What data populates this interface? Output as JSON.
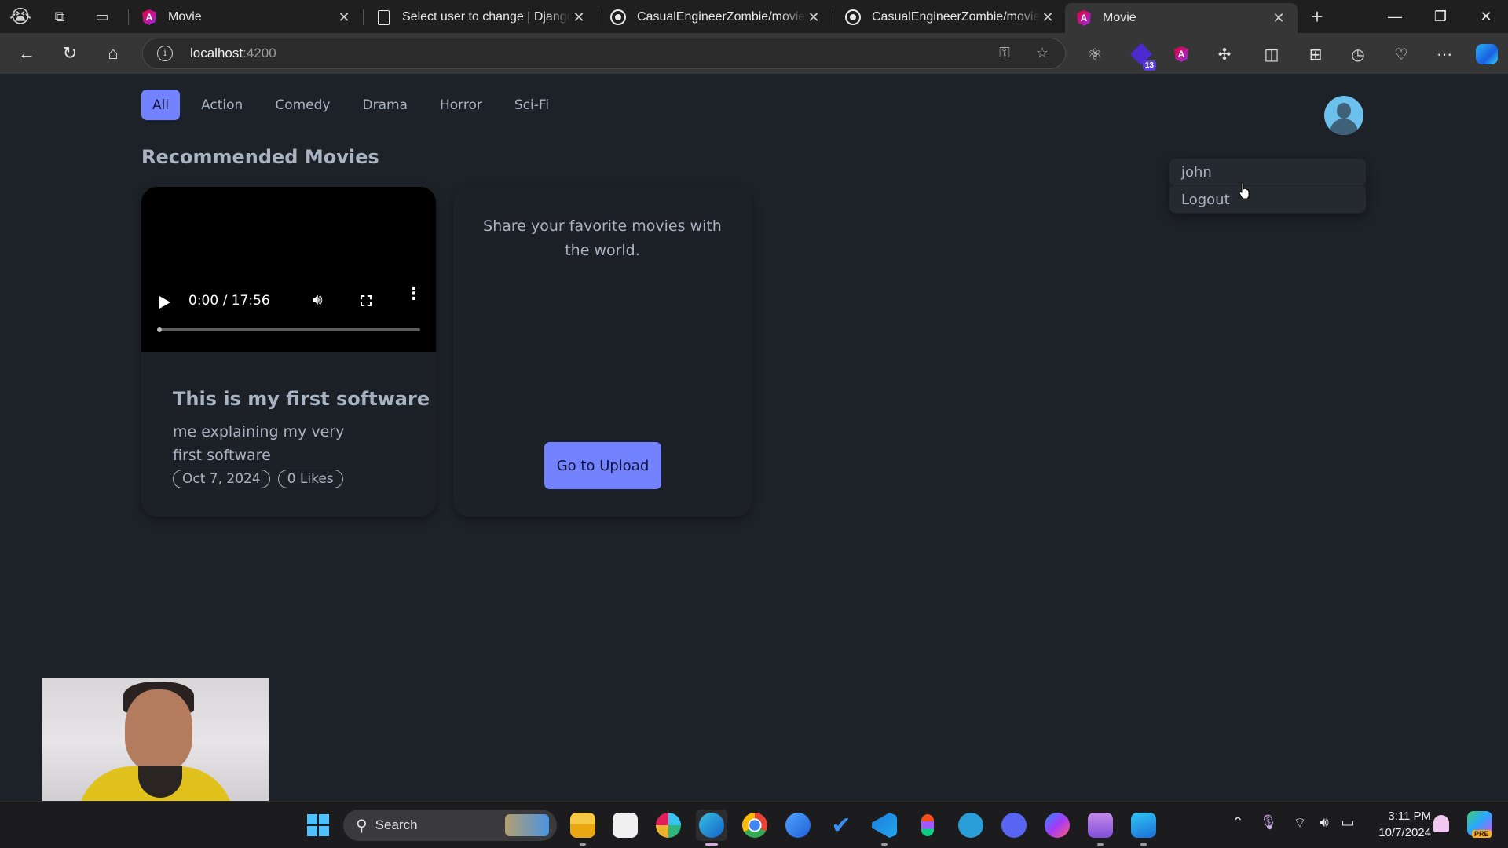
{
  "browser": {
    "tabs": [
      {
        "title": "Movie",
        "favicon": "angular-icon",
        "active": false
      },
      {
        "title": "Select user to change | Django site admin",
        "favicon": "document-icon",
        "active": false
      },
      {
        "title": "CasualEngineerZombie/movie-angular",
        "favicon": "github-icon",
        "active": false
      },
      {
        "title": "CasualEngineerZombie/movie-django",
        "favicon": "github-icon",
        "active": false
      },
      {
        "title": "Movie",
        "favicon": "angular-icon",
        "active": true
      }
    ],
    "new_tab_symbol": "+",
    "window_controls": {
      "minimize": "—",
      "restore": "❐",
      "close": "✕"
    },
    "address": {
      "host": "localhost",
      "port": ":4200"
    },
    "extension_badge": "13"
  },
  "app": {
    "filters": [
      {
        "label": "All",
        "active": true
      },
      {
        "label": "Action",
        "active": false
      },
      {
        "label": "Comedy",
        "active": false
      },
      {
        "label": "Drama",
        "active": false
      },
      {
        "label": "Horror",
        "active": false
      },
      {
        "label": "Sci-Fi",
        "active": false
      }
    ],
    "section_title": "Recommended Movies",
    "movies": [
      {
        "video": {
          "current_time": "0:00",
          "duration": "17:56",
          "time_display": "0:00 / 17:56",
          "progress": 0
        },
        "title": "This is my first software",
        "description": "me explaining my very first software",
        "date": "Oct 7, 2024",
        "likes": "0 Likes"
      }
    ],
    "upload_card": {
      "text": "Share your favorite movies with the world.",
      "button_label": "Go to Upload"
    },
    "user_menu": {
      "username": "john",
      "logout_label": "Logout"
    },
    "colors": {
      "accent": "#7383ff",
      "background": "#1d2229",
      "text": "#a9b4c2"
    }
  },
  "taskbar": {
    "search_placeholder": "Search",
    "apps": [
      "file-explorer",
      "microsoft-store",
      "slack",
      "edge",
      "chrome",
      "firefox",
      "todo",
      "vscode",
      "figma",
      "telegram",
      "discord",
      "messenger",
      "clipchamp",
      "remote-desktop"
    ],
    "time": "3:11 PM",
    "date": "10/7/2024",
    "copilot_badge": "PRE"
  }
}
